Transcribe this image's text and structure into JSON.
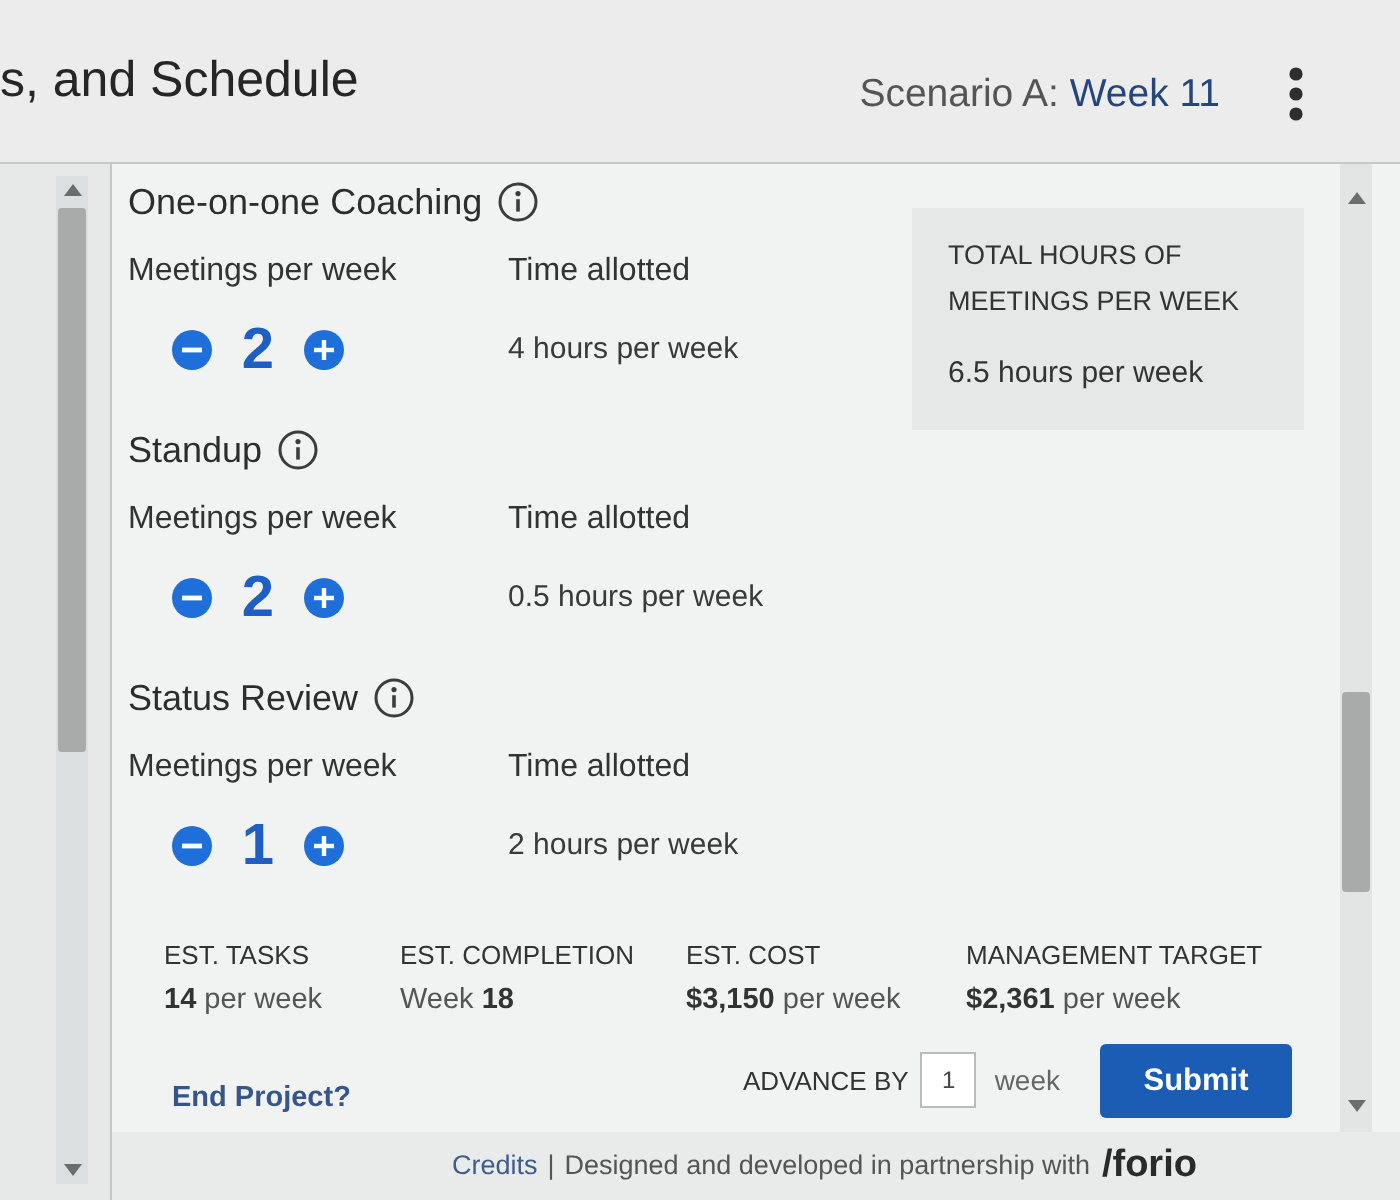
{
  "header": {
    "title": "s, and Schedule",
    "scenario_label": "Scenario A:",
    "scenario_week": "Week 11"
  },
  "meeting_types": [
    {
      "name": "One-on-one Coaching",
      "meetings_label": "Meetings per week",
      "count": "2",
      "time_label": "Time allotted",
      "time_value": "4 hours per week"
    },
    {
      "name": "Standup",
      "meetings_label": "Meetings per week",
      "count": "2",
      "time_label": "Time allotted",
      "time_value": "0.5 hours per week"
    },
    {
      "name": "Status Review",
      "meetings_label": "Meetings per week",
      "count": "1",
      "time_label": "Time allotted",
      "time_value": "2 hours per week"
    }
  ],
  "total": {
    "label": "TOTAL HOURS OF MEETINGS PER WEEK",
    "value": "6.5 hours per week"
  },
  "estimates": [
    {
      "label": "EST. TASKS",
      "value": "**14** per week"
    },
    {
      "label": "EST. COMPLETION",
      "value": "Week **18**"
    },
    {
      "label": "EST. COST",
      "value": "**$3,150** per week"
    },
    {
      "label": "MANAGEMENT TARGET",
      "value": "**$2,361** per week"
    }
  ],
  "end_project": "End Project?",
  "advance": {
    "label": "ADVANCE BY",
    "value": "1",
    "unit": "week"
  },
  "submit": "Submit",
  "footer": {
    "link": "Credits",
    "separator": "|",
    "text": "Designed and developed in partnership with",
    "logo": "/forio"
  }
}
